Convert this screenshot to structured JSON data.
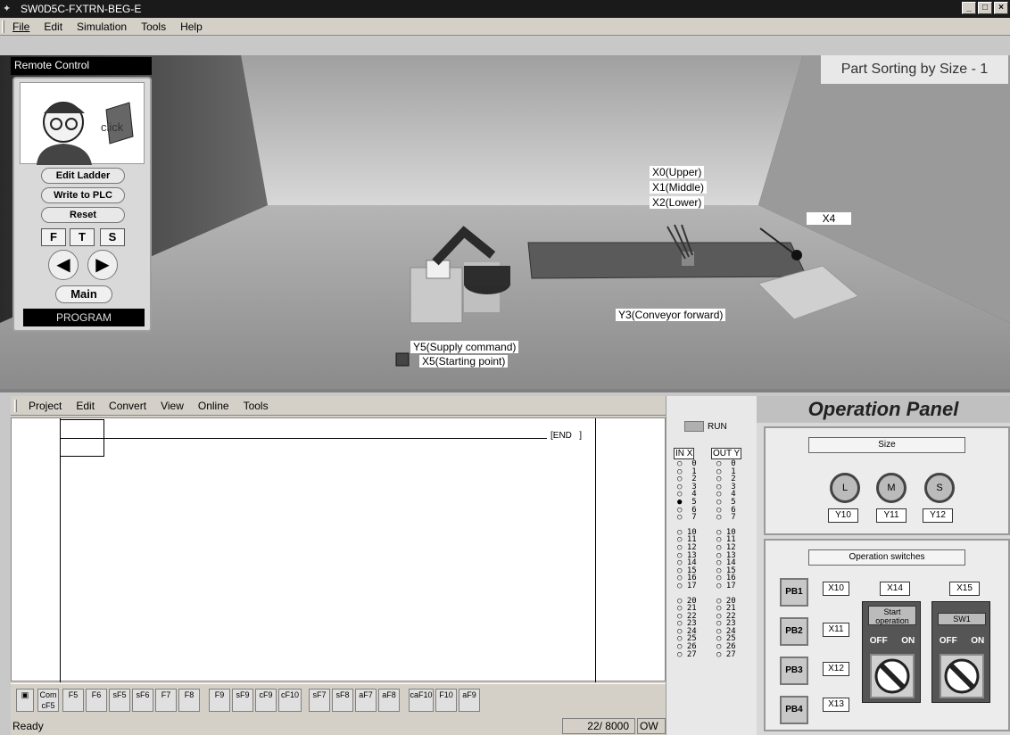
{
  "window": {
    "title": "SW0D5C-FXTRN-BEG-E",
    "controls": [
      "_",
      "□",
      "×"
    ]
  },
  "menubar": {
    "items": [
      "File",
      "Edit",
      "Simulation",
      "Tools",
      "Help"
    ]
  },
  "remote_control": {
    "header": "Remote Control",
    "avatar_text": "click",
    "buttons": {
      "edit_ladder": "Edit Ladder",
      "write_to_plc": "Write to PLC",
      "reset": "Reset",
      "f": "F",
      "t": "T",
      "s": "S",
      "main": "Main"
    },
    "mode": "PROGRAM"
  },
  "scene": {
    "title": "Part Sorting by Size - 1",
    "labels": {
      "x0": "X0(Upper)",
      "x1": "X1(Middle)",
      "x2": "X2(Lower)",
      "x4": "X4",
      "y3": "Y3(Conveyor forward)",
      "y5": "Y5(Supply command)",
      "x5": "X5(Starting point)"
    }
  },
  "ladder": {
    "menu": [
      "Project",
      "Edit",
      "Convert",
      "View",
      "Online",
      "Tools"
    ],
    "end_label": "END",
    "toolbar": [
      "Com cF5",
      "F5",
      "F6",
      "sF5",
      "sF6",
      "F7",
      "F8",
      "F9",
      "sF9",
      "cF9",
      "cF10",
      "sF7",
      "sF8",
      "aF7",
      "aF8",
      "caF10",
      "F10",
      "aF9"
    ],
    "status": {
      "ready": "Ready",
      "steps": "22/ 8000",
      "mode": "OW"
    }
  },
  "io_monitor": {
    "run_label": "RUN",
    "in_header": "IN X",
    "out_header": "OUT Y",
    "groups": [
      [
        "0",
        "1",
        "2",
        "3",
        "4",
        "5",
        "6",
        "7"
      ],
      [
        "10",
        "11",
        "12",
        "13",
        "14",
        "15",
        "16",
        "17"
      ],
      [
        "20",
        "21",
        "22",
        "23",
        "24",
        "25",
        "26",
        "27"
      ]
    ],
    "active_inputs": [
      "5"
    ]
  },
  "operation_panel": {
    "title": "Operation Panel",
    "size_section": {
      "label": "Size",
      "lamps": [
        "L",
        "M",
        "S"
      ],
      "outputs": [
        "Y10",
        "Y11",
        "Y12"
      ]
    },
    "switch_section": {
      "label": "Operation switches",
      "pushbuttons": [
        "PB1",
        "PB2",
        "PB3",
        "PB4"
      ],
      "pb_inputs": [
        "X10",
        "X11",
        "X12",
        "X13"
      ],
      "switch_inputs": [
        "X14",
        "X15"
      ],
      "start_label": "Start operation",
      "sw1_label": "SW1",
      "off": "OFF",
      "on": "ON"
    }
  },
  "colors": {
    "titlebar": "#1a1a1a",
    "chrome": "#d4d0c8",
    "panel_bg": "#d8d8d8"
  }
}
